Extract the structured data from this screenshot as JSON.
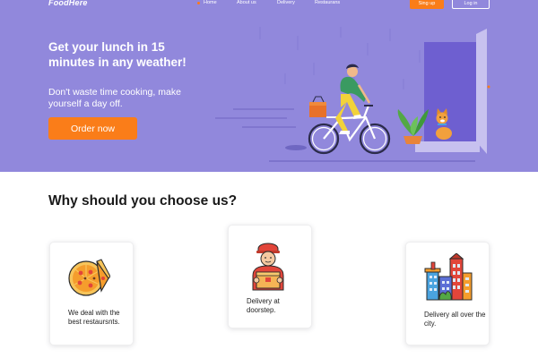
{
  "brand": {
    "logo": "FoodHere",
    "primary_color": "#9188dc",
    "accent_color": "#fa7d19"
  },
  "nav": {
    "links": [
      "Home",
      "About us",
      "Delivery",
      "Restaurans"
    ],
    "signup_label": "Sing up",
    "login_label": "Log in"
  },
  "hero": {
    "title": "Get your lunch in 15 minutes in any weather!",
    "subtitle": "Don't waste time cooking, make yourself a day off.",
    "cta_label": "Order now",
    "illustration": "delivery-bike-illustration"
  },
  "section": {
    "title": "Why should you choose us?",
    "features": [
      {
        "icon": "pizza-icon",
        "text": "We deal with the best restaursnts."
      },
      {
        "icon": "courier-icon",
        "text": "Delivery at doorstep."
      },
      {
        "icon": "city-buildings-icon",
        "text": "Delivery all over the city."
      }
    ]
  }
}
